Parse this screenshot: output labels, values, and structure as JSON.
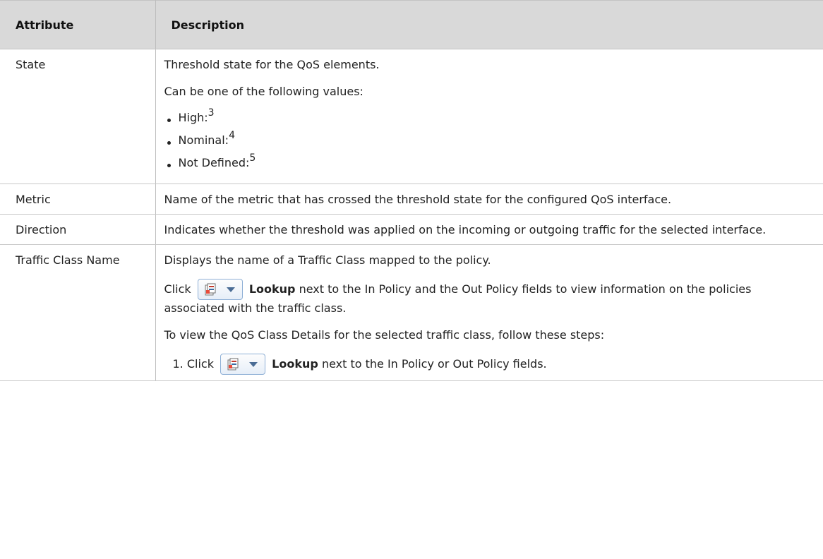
{
  "header": {
    "attribute": "Attribute",
    "description": "Description"
  },
  "rows": [
    {
      "attribute": "State",
      "desc_line1": "Threshold state for the QoS elements.",
      "desc_line2": "Can be one of the following values:",
      "values": [
        {
          "label": "High:",
          "sup": "3"
        },
        {
          "label": "Nominal:",
          "sup": "4"
        },
        {
          "label": "Not Defined:",
          "sup": "5"
        }
      ]
    },
    {
      "attribute": "Metric",
      "description": "Name of the metric that has crossed the threshold state for the configured QoS interface."
    },
    {
      "attribute": "Direction",
      "description": "Indicates whether the threshold was applied on the incoming or outgoing traffic for the selected interface."
    },
    {
      "attribute": "Traffic Class Name",
      "desc_line1": "Displays the name of a Traffic Class mapped to the policy.",
      "click_prefix": "Click",
      "lookup_label": "Lookup",
      "click_suffix": "next to the In Policy and the Out Policy fields to view information on the policies associated with the traffic class.",
      "steps_intro": "To view the QoS Class Details for the selected traffic class, follow these steps:",
      "step1_number": "1.",
      "step1_prefix": "Click",
      "step1_lookup": "Lookup",
      "step1_suffix": "next to the In Policy or Out Policy fields."
    }
  ],
  "icons": {
    "lookup_button": "lookup-dropdown-icon"
  }
}
